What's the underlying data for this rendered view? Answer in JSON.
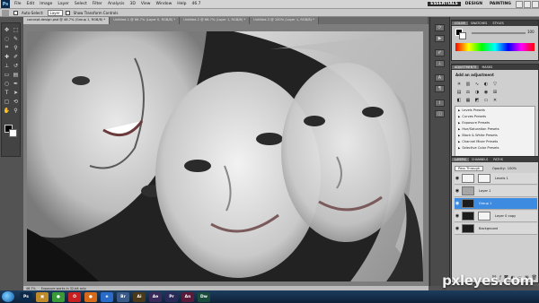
{
  "menu": {
    "items": [
      "File",
      "Edit",
      "Image",
      "Layer",
      "Select",
      "Filter",
      "Analysis",
      "3D",
      "View",
      "Window",
      "Help"
    ],
    "workspaces": [
      "ESSENTIALS",
      "DESIGN",
      "PAINTING"
    ],
    "active_workspace": "ESSENTIALS",
    "zoom_value": "46.7"
  },
  "options": {
    "auto_select_label": "Auto-Select:",
    "auto_select_value": "Layer",
    "show_transform_label": "Show Transform Controls"
  },
  "tabs": [
    {
      "label": "concept-design.psd @ 46.7% (Group 1, RGB/8) *",
      "active": true
    },
    {
      "label": "Untitled-1 @ 66.7% (Layer 0, RGB/8) *",
      "active": false
    },
    {
      "label": "Untitled-2 @ 66.7% (Layer 1, RGB/8) *",
      "active": false
    },
    {
      "label": "Untitled-3 @ 100% (Layer 1, RGB/8) *",
      "active": false
    }
  ],
  "color_panel": {
    "tabs": [
      "COLOR",
      "SWATCHES",
      "STYLES"
    ],
    "value": "100",
    "fg_color": "#000000",
    "bg_color": "#ffffff"
  },
  "adjustments_panel": {
    "tabs": [
      "ADJUSTMENTS",
      "MASKS"
    ],
    "title": "Add an adjustment",
    "presets": [
      "Levels Presets",
      "Curves Presets",
      "Exposure Presets",
      "Hue/Saturation Presets",
      "Black & White Presets",
      "Channel Mixer Presets",
      "Selective Color Presets"
    ]
  },
  "layers_panel": {
    "tabs": [
      "LAYERS",
      "CHANNELS",
      "PATHS"
    ],
    "blend_mode": "Pass Through",
    "opacity_label": "Opacity:",
    "opacity": "100%",
    "fill_label": "Fill:",
    "fill": "100%",
    "layers": [
      {
        "name": "Levels 1",
        "thumb": "light",
        "selected": false
      },
      {
        "name": "Layer 1",
        "thumb": "mid",
        "selected": false
      },
      {
        "name": "Group 1",
        "thumb": "dark",
        "selected": true
      },
      {
        "name": "Layer 0 copy",
        "thumb": "dark",
        "selected": false
      },
      {
        "name": "Background",
        "thumb": "dark",
        "selected": false
      }
    ]
  },
  "status": {
    "zoom": "46.7%",
    "doc": "Exposure works in 32-bit only"
  },
  "taskbar": {
    "apps": [
      {
        "icon": "ps-icon",
        "label": "Ps",
        "color": "#0b2a4a"
      },
      {
        "icon": "files-icon",
        "label": "▣",
        "color": "#c08a2a"
      },
      {
        "icon": "chrome-icon",
        "label": "●",
        "color": "#3a9a3a"
      },
      {
        "icon": "opera-icon",
        "label": "O",
        "color": "#c82020"
      },
      {
        "icon": "firefox-icon",
        "label": "●",
        "color": "#d46a1a"
      },
      {
        "icon": "ie-icon",
        "label": "e",
        "color": "#2a6ac8"
      },
      {
        "icon": "br-icon",
        "label": "Br",
        "color": "#3a5a8a"
      },
      {
        "icon": "ai-icon",
        "label": "Ai",
        "color": "#4a3a1a"
      },
      {
        "icon": "ae-icon",
        "label": "Ae",
        "color": "#3a2a5a"
      },
      {
        "icon": "pr-icon",
        "label": "Pr",
        "color": "#2a2a5a"
      },
      {
        "icon": "an-icon",
        "label": "An",
        "color": "#5a1a3a"
      },
      {
        "icon": "dw-icon",
        "label": "Dw",
        "color": "#1a4a3a"
      }
    ],
    "watermark": "pxleyes.com"
  }
}
